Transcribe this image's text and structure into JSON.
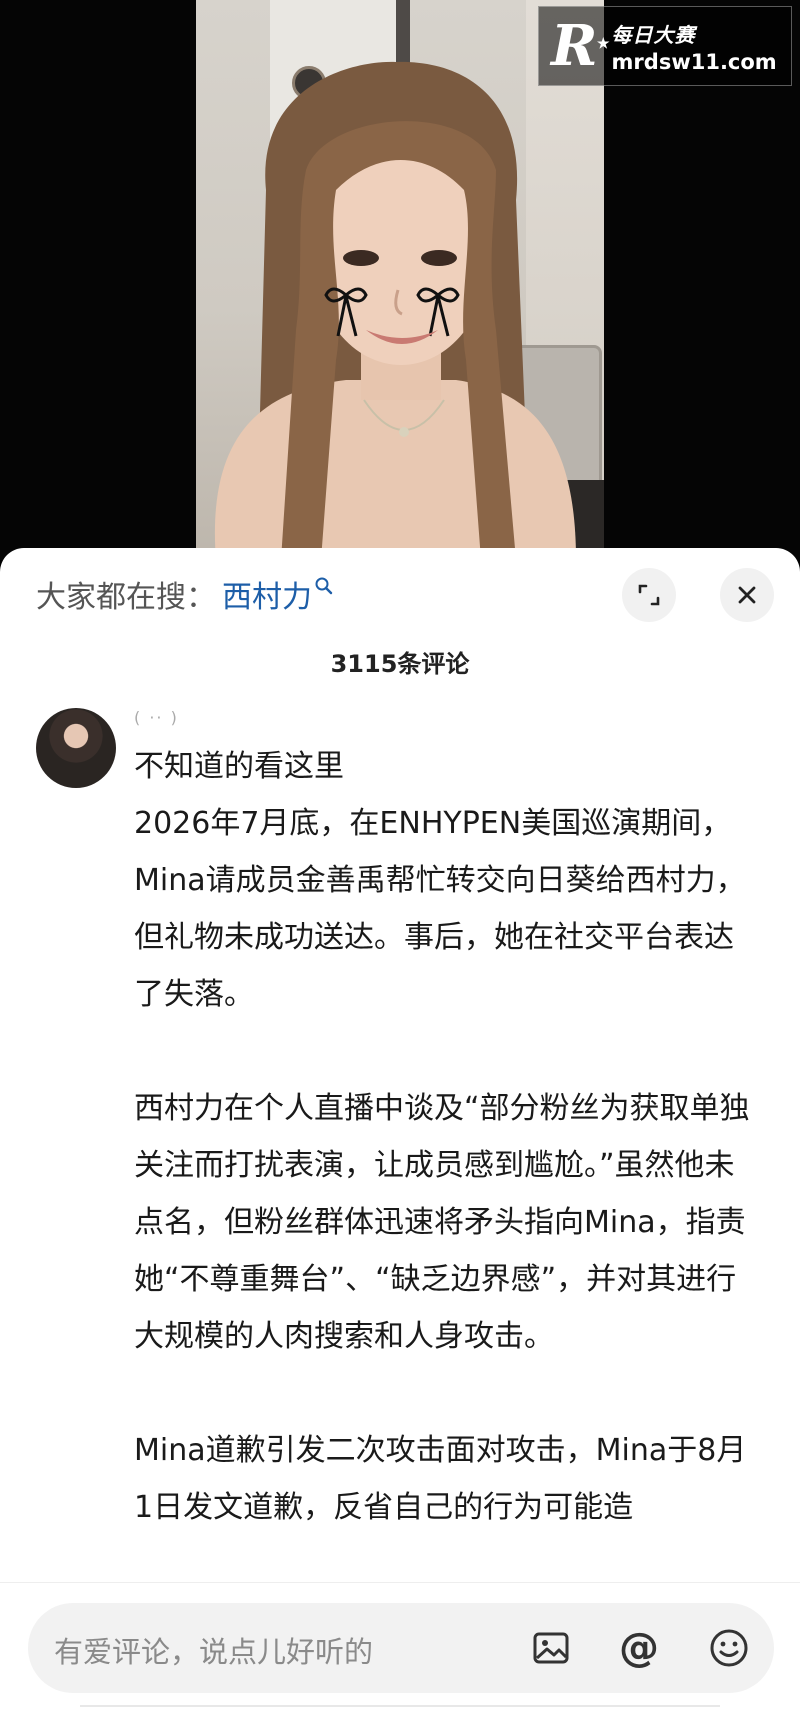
{
  "watermark": {
    "logo_letter": "R",
    "name": "每日大赛",
    "domain": "mrdsw11.com"
  },
  "search": {
    "prefix": "大家都在搜：",
    "term": "西村力",
    "icon": "search-icon"
  },
  "header_buttons": {
    "expand_icon": "expand-icon",
    "close_icon": "close-icon"
  },
  "comments_count": "3115条评论",
  "comment": {
    "meta": "( ·· )",
    "paragraphs": [
      "不知道的看这里",
      "2026年7月底，在ENHYPEN美国巡演期间，Mina请成员金善禹帮忙转交向日葵给西村力，但礼物未成功送达。事后，她在社交平台表达了失落。",
      "西村力在个人直播中谈及“部分粉丝为获取单独关注而打扰表演，让成员感到尴尬。”虽然他未点名，但粉丝群体迅速将矛头指向Mina，指责她“不尊重舞台”、“缺乏边界感”，并对其进行大规模的人肉搜索和人身攻击。",
      "Mina道歉引发二次攻击面对攻击，Mina于8月1日发文道歉，反省自己的行为可能造"
    ]
  },
  "input": {
    "placeholder": "有爱评论，说点儿好听的",
    "image_icon": "image-icon",
    "at_label": "@",
    "emoji_icon": "emoji-icon"
  }
}
